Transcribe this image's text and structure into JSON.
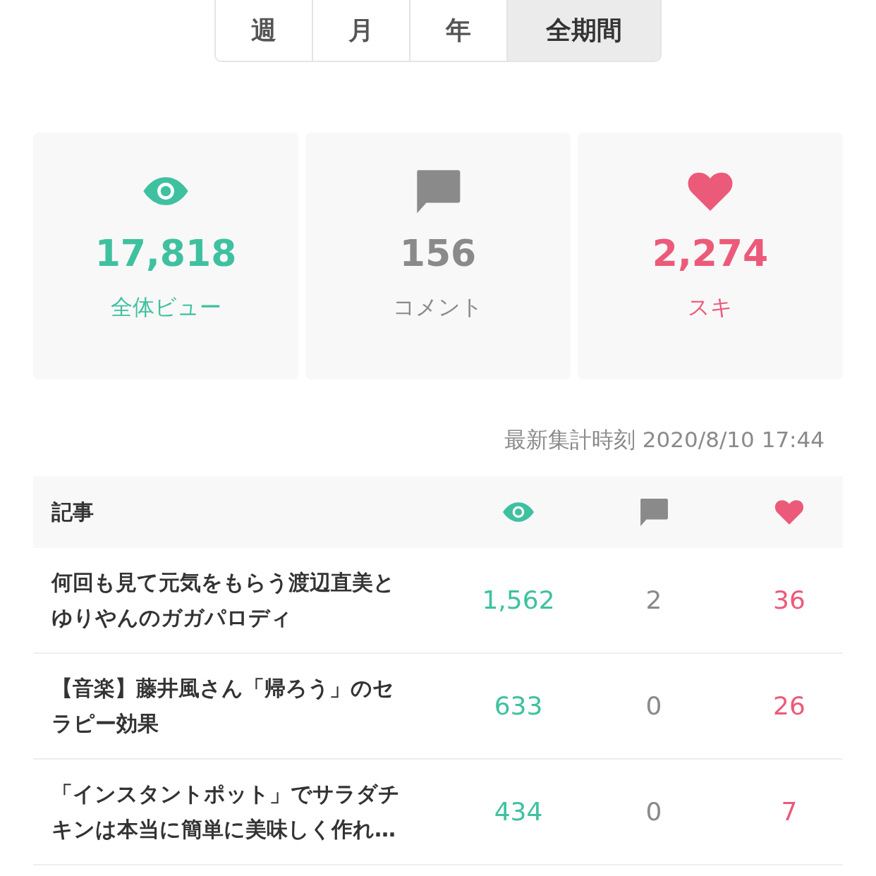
{
  "period_tabs": [
    {
      "label": "週",
      "selected": false
    },
    {
      "label": "月",
      "selected": false
    },
    {
      "label": "年",
      "selected": false
    },
    {
      "label": "全期間",
      "selected": true
    }
  ],
  "stats": [
    {
      "kind": "views",
      "value": "17,818",
      "label": "全体ビュー"
    },
    {
      "kind": "comments",
      "value": "156",
      "label": "コメント"
    },
    {
      "kind": "likes",
      "value": "2,274",
      "label": "スキ"
    }
  ],
  "updated": "最新集計時刻 2020/8/10 17:44",
  "table": {
    "column_label": "記事",
    "columns": [
      {
        "kind": "views"
      },
      {
        "kind": "comments"
      },
      {
        "kind": "likes"
      }
    ],
    "rows": [
      {
        "title": "何回も見て元気をもらう渡辺直美とゆりやんのガガパロディ",
        "views": "1,562",
        "comments": "2",
        "likes": "36"
      },
      {
        "title": "【音楽】藤井風さん「帰ろう」のセラピー効果",
        "views": "633",
        "comments": "0",
        "likes": "26"
      },
      {
        "title": "「インスタントポット」でサラダチキンは本当に簡単に美味しく作れ…",
        "views": "434",
        "comments": "0",
        "likes": "7"
      }
    ]
  }
}
